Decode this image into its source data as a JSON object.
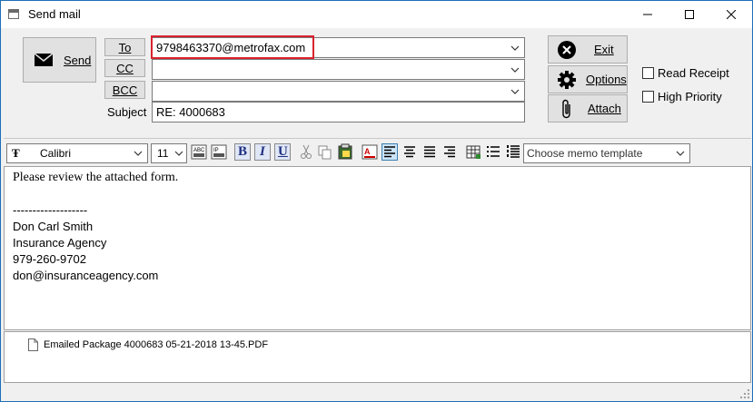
{
  "window": {
    "title": "Send mail"
  },
  "actions": {
    "send_label": "Send",
    "exit_label": "Exit",
    "options_label": "Options",
    "attach_label": "Attach"
  },
  "fields": {
    "to_label": "To",
    "cc_label": "CC",
    "bcc_label": "BCC",
    "subject_label": "Subject",
    "to_value": "9798463370@metrofax.com",
    "cc_value": "",
    "bcc_value": "",
    "subject_value": "RE: 4000683"
  },
  "checkboxes": {
    "read_receipt": "Read Receipt",
    "high_priority": "High Priority"
  },
  "toolbar": {
    "font_name": "Calibri",
    "font_size": "11",
    "memo_template_placeholder": "Choose memo template"
  },
  "message": {
    "line1": "Please review the attached form.",
    "separator": "-------------------",
    "sig_name": "Don Carl Smith",
    "sig_company": "Insurance Agency",
    "sig_phone": "979-260-9702",
    "sig_email": "don@insuranceagency.com"
  },
  "attachments": [
    {
      "filename": "Emailed Package 4000683 05-21-2018 13-45.PDF"
    }
  ],
  "colors": {
    "highlight": "#d9232e",
    "accent": "#1e6fb8"
  }
}
